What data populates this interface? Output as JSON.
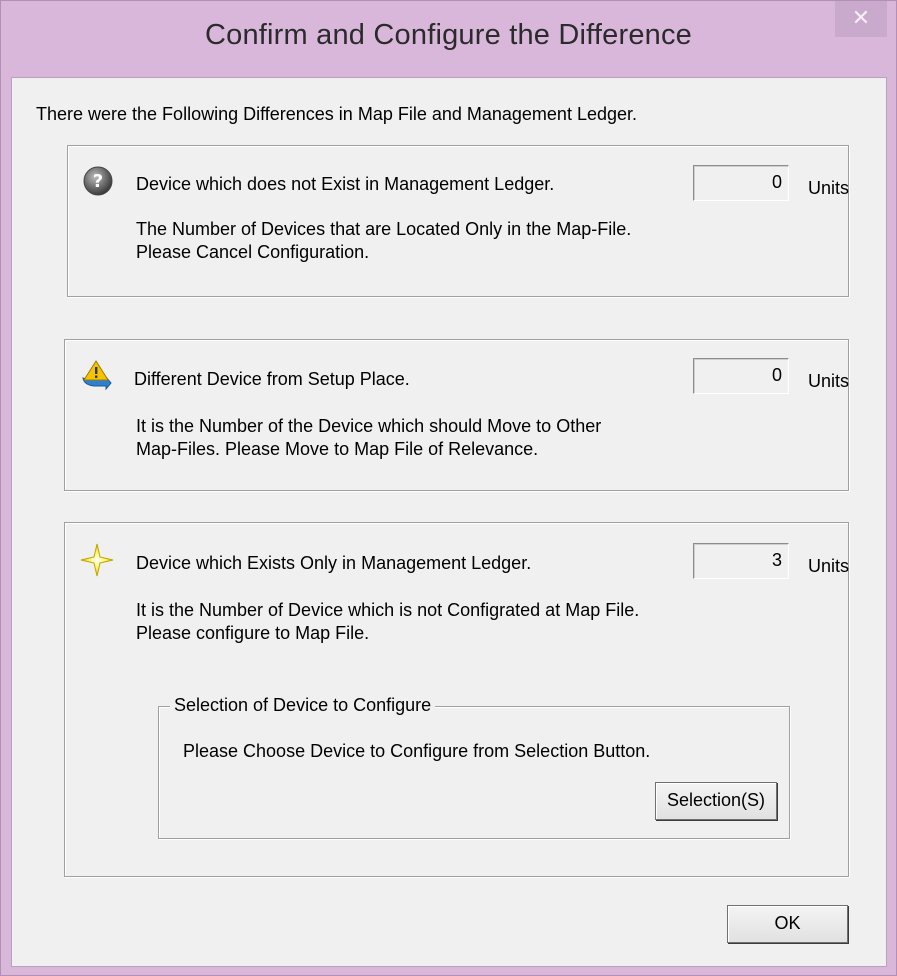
{
  "window": {
    "title": "Confirm and Configure the Difference",
    "close_glyph": "✕"
  },
  "intro_text": "There were the Following Differences in Map File and Management Ledger.",
  "groups": [
    {
      "icon": "question-icon",
      "label": "Device which does not Exist in Management Ledger.",
      "count": "0",
      "units": "Units",
      "desc_line1": "The Number of Devices that are Located Only in the Map-File.",
      "desc_line2": "Please Cancel Configuration."
    },
    {
      "icon": "move-warning-icon",
      "label": "Different Device from Setup Place.",
      "count": "0",
      "units": "Units",
      "desc_line1": "It is the Number of the Device which should Move to Other",
      "desc_line2": "Map-Files. Please Move to Map File of Relevance."
    },
    {
      "icon": "star-icon",
      "label": "Device which Exists Only in Management Ledger.",
      "count": "3",
      "units": "Units",
      "desc_line1": "It is the Number of Device which is not Configrated at Map File.",
      "desc_line2": "Please configure to Map File."
    }
  ],
  "selection_group": {
    "legend": "Selection of Device to Configure",
    "instruction": "Please Choose Device to Configure from Selection Button.",
    "button_label": "Selection(S)"
  },
  "ok_label": "OK",
  "colors": {
    "titlebar": "#d8b7da",
    "client_bg": "#f0f0f0"
  }
}
